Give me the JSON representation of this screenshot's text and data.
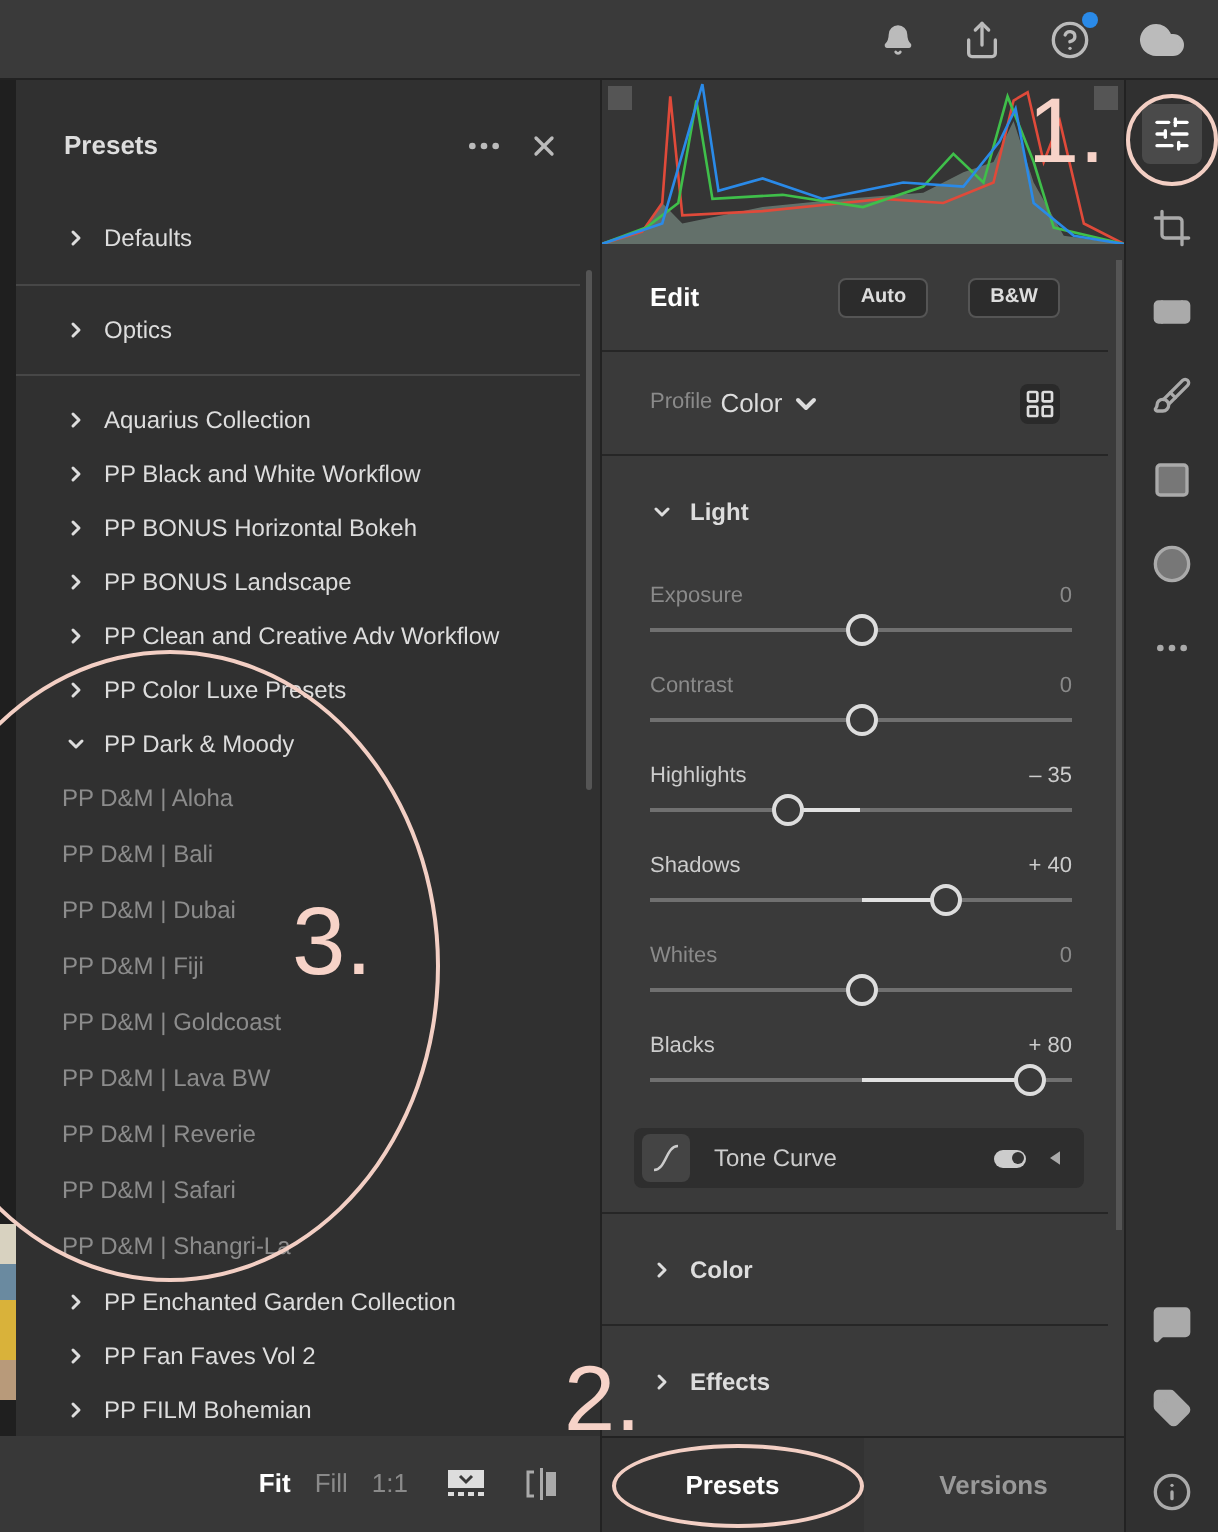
{
  "presets_panel": {
    "title": "Presets",
    "sections": [
      {
        "label": "Defaults",
        "expanded": false
      },
      {
        "label": "Optics",
        "expanded": false
      }
    ],
    "groups": [
      {
        "label": "Aquarius Collection",
        "expanded": false
      },
      {
        "label": "PP Black and White Workflow",
        "expanded": false
      },
      {
        "label": "PP BONUS Horizontal Bokeh",
        "expanded": false
      },
      {
        "label": "PP BONUS Landscape",
        "expanded": false
      },
      {
        "label": "PP Clean and Creative Adv Workflow",
        "expanded": false
      },
      {
        "label": "PP Color Luxe Presets",
        "expanded": false
      },
      {
        "label": "PP Dark & Moody",
        "expanded": true,
        "children": [
          {
            "label": "PP D&M | Aloha"
          },
          {
            "label": "PP D&M | Bali"
          },
          {
            "label": "PP D&M | Dubai"
          },
          {
            "label": "PP D&M | Fiji"
          },
          {
            "label": "PP D&M | Goldcoast"
          },
          {
            "label": "PP D&M | Lava BW"
          },
          {
            "label": "PP D&M | Reverie"
          },
          {
            "label": "PP D&M | Safari"
          },
          {
            "label": "PP D&M | Shangri-La"
          }
        ]
      },
      {
        "label": "PP Enchanted Garden Collection",
        "expanded": false
      },
      {
        "label": "PP Fan Faves Vol 2",
        "expanded": false
      },
      {
        "label": "PP FILM Bohemian",
        "expanded": false
      }
    ]
  },
  "view_bar": {
    "zoom_options": [
      {
        "label": "Fit",
        "selected": true
      },
      {
        "label": "Fill",
        "selected": false
      },
      {
        "label": "1:1",
        "selected": false
      }
    ]
  },
  "edit_panel": {
    "title": "Edit",
    "buttons": [
      "Auto",
      "B&W"
    ],
    "profile": {
      "label": "Profile",
      "value": "Color"
    },
    "light": {
      "label": "Light",
      "expanded": true,
      "sliders": [
        {
          "label": "Exposure",
          "value": "0",
          "changed": false,
          "level": 0.5
        },
        {
          "label": "Contrast",
          "value": "0",
          "changed": false,
          "level": 0.5
        },
        {
          "label": "Highlights",
          "value": "– 35",
          "changed": true,
          "level": 0.325
        },
        {
          "label": "Shadows",
          "value": "+ 40",
          "changed": true,
          "level": 0.7
        },
        {
          "label": "Whites",
          "value": "0",
          "changed": false,
          "level": 0.5
        },
        {
          "label": "Blacks",
          "value": "+ 80",
          "changed": true,
          "level": 0.9
        }
      ]
    },
    "tone_curve": {
      "label": "Tone Curve",
      "on": true
    },
    "sections": [
      {
        "label": "Color",
        "expanded": false
      },
      {
        "label": "Effects",
        "expanded": false
      }
    ]
  },
  "bottom_tabs": [
    {
      "label": "Presets",
      "selected": true
    },
    {
      "label": "Versions",
      "selected": false
    }
  ],
  "annotations": [
    {
      "label": "1."
    },
    {
      "label": "2."
    },
    {
      "label": "3."
    }
  ]
}
